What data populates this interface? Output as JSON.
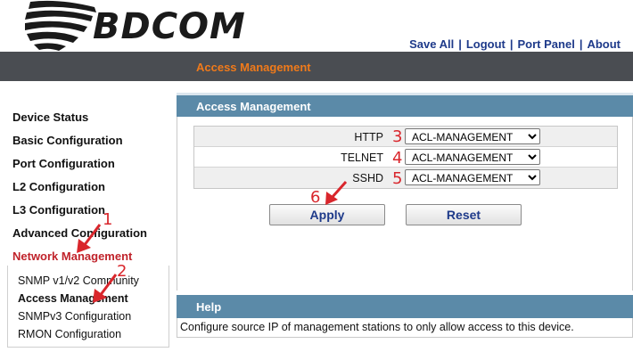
{
  "brand": {
    "name": "BDCOM"
  },
  "toplinks": [
    {
      "label": "Save All"
    },
    {
      "label": "Logout"
    },
    {
      "label": "Port Panel"
    },
    {
      "label": "About"
    }
  ],
  "titlebar": {
    "title": "Access Management"
  },
  "sidebar": {
    "items": [
      {
        "label": "Device Status"
      },
      {
        "label": "Basic Configuration"
      },
      {
        "label": "Port Configuration"
      },
      {
        "label": "L2 Configuration"
      },
      {
        "label": "L3 Configuration"
      },
      {
        "label": "Advanced Configuration"
      },
      {
        "label": "Network Management"
      }
    ],
    "submenu": [
      {
        "label": "SNMP v1/v2 Community"
      },
      {
        "label": "Access Management"
      },
      {
        "label": "SNMPv3 Configuration"
      },
      {
        "label": "RMON Configuration"
      }
    ]
  },
  "main": {
    "header": "Access Management",
    "rows": [
      {
        "label": "HTTP",
        "value": "ACL-MANAGEMENT"
      },
      {
        "label": "TELNET",
        "value": "ACL-MANAGEMENT"
      },
      {
        "label": "SSHD",
        "value": "ACL-MANAGEMENT"
      }
    ],
    "apply_label": "Apply",
    "reset_label": "Reset"
  },
  "help": {
    "header": "Help",
    "text": "Configure source IP of management stations to only allow access to this device."
  },
  "annotations": [
    "1",
    "2",
    "3",
    "4",
    "5",
    "6"
  ],
  "colors": {
    "annotation": "#d9262c",
    "panel_header": "#5b8aa8",
    "titlebar": "#4a4d52",
    "active_title": "#f07a1a"
  }
}
